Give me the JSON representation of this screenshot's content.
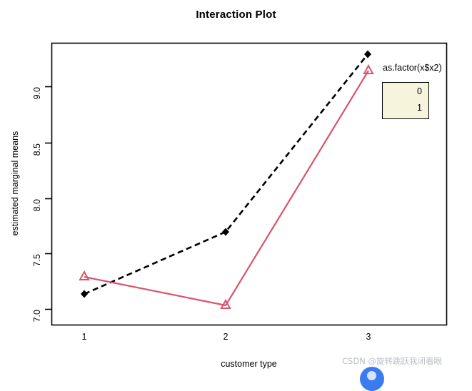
{
  "title": "Interaction Plot",
  "axes": {
    "x_label": "customer type",
    "y_label": "estimated marginal means",
    "x_ticks": [
      "1",
      "2",
      "3"
    ],
    "y_ticks": [
      "7.0",
      "7.5",
      "8.0",
      "8.5",
      "9.0"
    ]
  },
  "legend": {
    "title": "as.factor(x$x2)",
    "entries": [
      {
        "label": "0",
        "color": "#000000",
        "marker": "filled-diamond",
        "linestyle": "dashed"
      },
      {
        "label": "1",
        "color": "#D9536B",
        "marker": "open-triangle",
        "linestyle": "solid"
      }
    ]
  },
  "watermark": {
    "text": "CSDN @旋转跳跃我闭着眼"
  },
  "colors": {
    "series_0": "#000000",
    "series_1": "#D9536B",
    "legend_background": "#F7F4DC",
    "frame": "#000000"
  },
  "chart_data": {
    "type": "line",
    "title": "Interaction Plot",
    "xlabel": "customer type",
    "ylabel": "estimated marginal means",
    "categories": [
      "1",
      "2",
      "3"
    ],
    "x": [
      1,
      2,
      3
    ],
    "series": [
      {
        "name": "0",
        "values": [
          7.07,
          7.65,
          9.29
        ],
        "color": "#000000",
        "linestyle": "dashed",
        "marker": "filled-diamond"
      },
      {
        "name": "1",
        "values": [
          7.22,
          6.97,
          9.14
        ],
        "color": "#D9536B",
        "linestyle": "solid",
        "marker": "open-triangle"
      }
    ],
    "ylim": [
      6.78,
      9.4
    ],
    "yticks": [
      7.0,
      7.5,
      8.0,
      8.5,
      9.0
    ],
    "xticks": [
      1,
      2,
      3
    ],
    "grid": false,
    "legend_position": "right",
    "legend_title": "as.factor(x$x2)"
  }
}
